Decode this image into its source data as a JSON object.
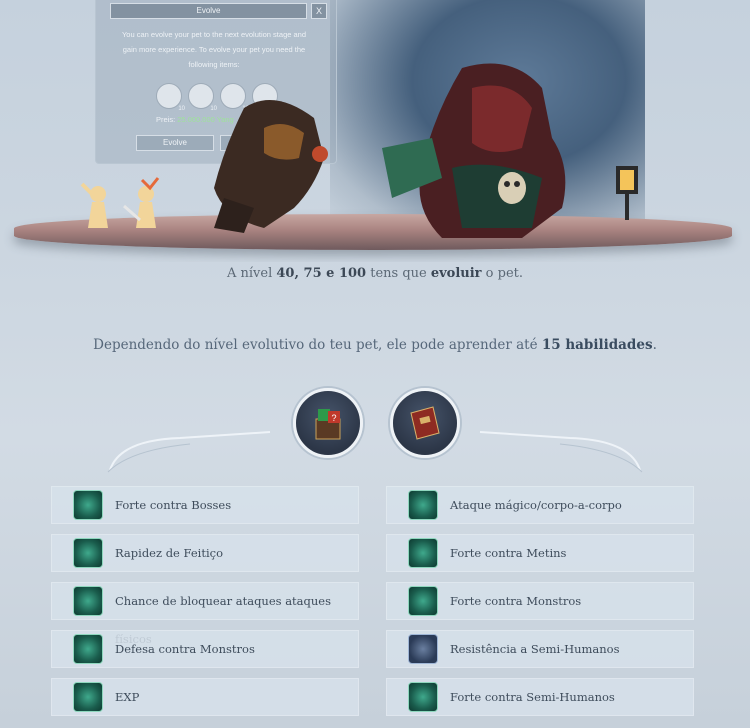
{
  "evolve_window": {
    "title": "Evolve",
    "close": "X",
    "description": "You can evolve your pet to the next evolution stage and gain more experience. To evolve your pet you need the following items:",
    "item_counts": [
      "10",
      "10",
      "10",
      "10"
    ],
    "price_label": "Preis:",
    "price_value": "25.000.000 Yang",
    "button_label": "Evolve"
  },
  "level_line": {
    "prefix": "A nível ",
    "levels": "40, 75 e 100",
    "middle": " tens que ",
    "evolve_word": "evoluir",
    "suffix": " o pet."
  },
  "abilities_line": {
    "prefix": "Dependendo do nível evolutivo do teu pet, ele pode aprender até ",
    "count": "15 habilidades",
    "suffix": "."
  },
  "skills_left": [
    {
      "label": "Forte contra Bosses",
      "icon": "sword-icon"
    },
    {
      "label": "Rapidez de Feitiço",
      "icon": "book-icon"
    },
    {
      "label": "Chance de bloquear ataques ataques físicos",
      "icon": "block-shield-icon"
    },
    {
      "label": "Defesa contra Monstros",
      "icon": "monster-defense-icon"
    },
    {
      "label": "EXP",
      "icon": "pet-exp-icon"
    }
  ],
  "skills_right": [
    {
      "label": "Ataque mágico/corpo-a-corpo",
      "icon": "magic-melee-icon"
    },
    {
      "label": "Forte contra Metins",
      "icon": "metin-stone-icon"
    },
    {
      "label": "Forte contra Monstros",
      "icon": "monster-icon"
    },
    {
      "label": "Resistência a Semi-Humanos",
      "icon": "semi-human-resist-icon"
    },
    {
      "label": "Forte contra Semi-Humanos",
      "icon": "semi-human-icon"
    }
  ],
  "category_icons": [
    "mystery-box-icon",
    "skill-book-icon"
  ],
  "colors": {
    "skill_green": "#2f8f74",
    "text_dark": "#3e4c5b",
    "price_green": "#9ee39a"
  }
}
